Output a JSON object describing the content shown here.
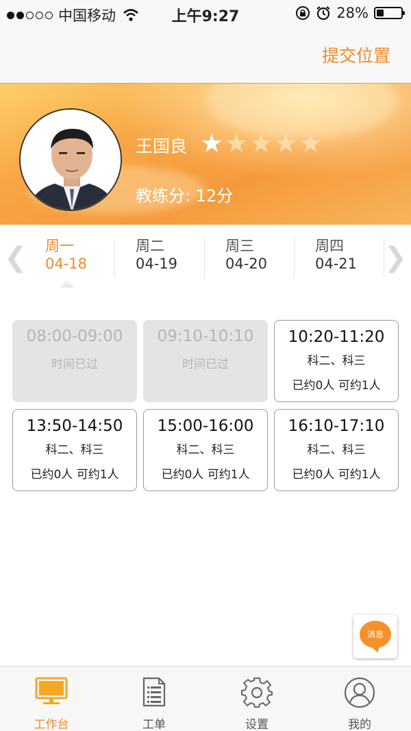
{
  "status_bar": {
    "carrier": "中国移动",
    "time": "上午9:27",
    "battery": "28%",
    "battery_level": 0.28,
    "icons": [
      "signal-dots-icon",
      "wifi-icon",
      "orientation-lock-icon",
      "alarm-icon",
      "battery-icon"
    ]
  },
  "nav": {
    "submit_label": "提交位置"
  },
  "coach": {
    "name": "王国良",
    "rating": 1,
    "rating_max": 5,
    "score_label": "教练分:",
    "score_value": "12分"
  },
  "week": {
    "days": [
      {
        "name": "周一",
        "date": "04-18",
        "active": true
      },
      {
        "name": "周二",
        "date": "04-19",
        "active": false
      },
      {
        "name": "周三",
        "date": "04-20",
        "active": false
      },
      {
        "name": "周四",
        "date": "04-21",
        "active": false
      }
    ]
  },
  "slots": [
    {
      "time": "08:00-09:00",
      "status": "时间已过",
      "past": true
    },
    {
      "time": "09:10-10:10",
      "status": "时间已过",
      "past": true
    },
    {
      "time": "10:20-11:20",
      "subjects": "科二、科三",
      "counts": "已约0人 可约1人",
      "past": false
    },
    {
      "time": "13:50-14:50",
      "subjects": "科二、科三",
      "counts": "已约0人 可约1人",
      "past": false
    },
    {
      "time": "15:00-16:00",
      "subjects": "科二、科三",
      "counts": "已约0人 可约1人",
      "past": false
    },
    {
      "time": "16:10-17:10",
      "subjects": "科二、科三",
      "counts": "已约0人 可约1人",
      "past": false
    }
  ],
  "message_button": {
    "label": "消息"
  },
  "tabbar": {
    "tabs": [
      {
        "label": "工作台",
        "icon": "monitor-icon",
        "active": true
      },
      {
        "label": "工单",
        "icon": "document-icon",
        "active": false
      },
      {
        "label": "设置",
        "icon": "gear-icon",
        "active": false
      },
      {
        "label": "我的",
        "icon": "user-icon",
        "active": false
      }
    ]
  },
  "colors": {
    "accent": "#f08a24",
    "banner_orange": "#f59a3c",
    "past_slot_bg": "#e4e4e4"
  }
}
